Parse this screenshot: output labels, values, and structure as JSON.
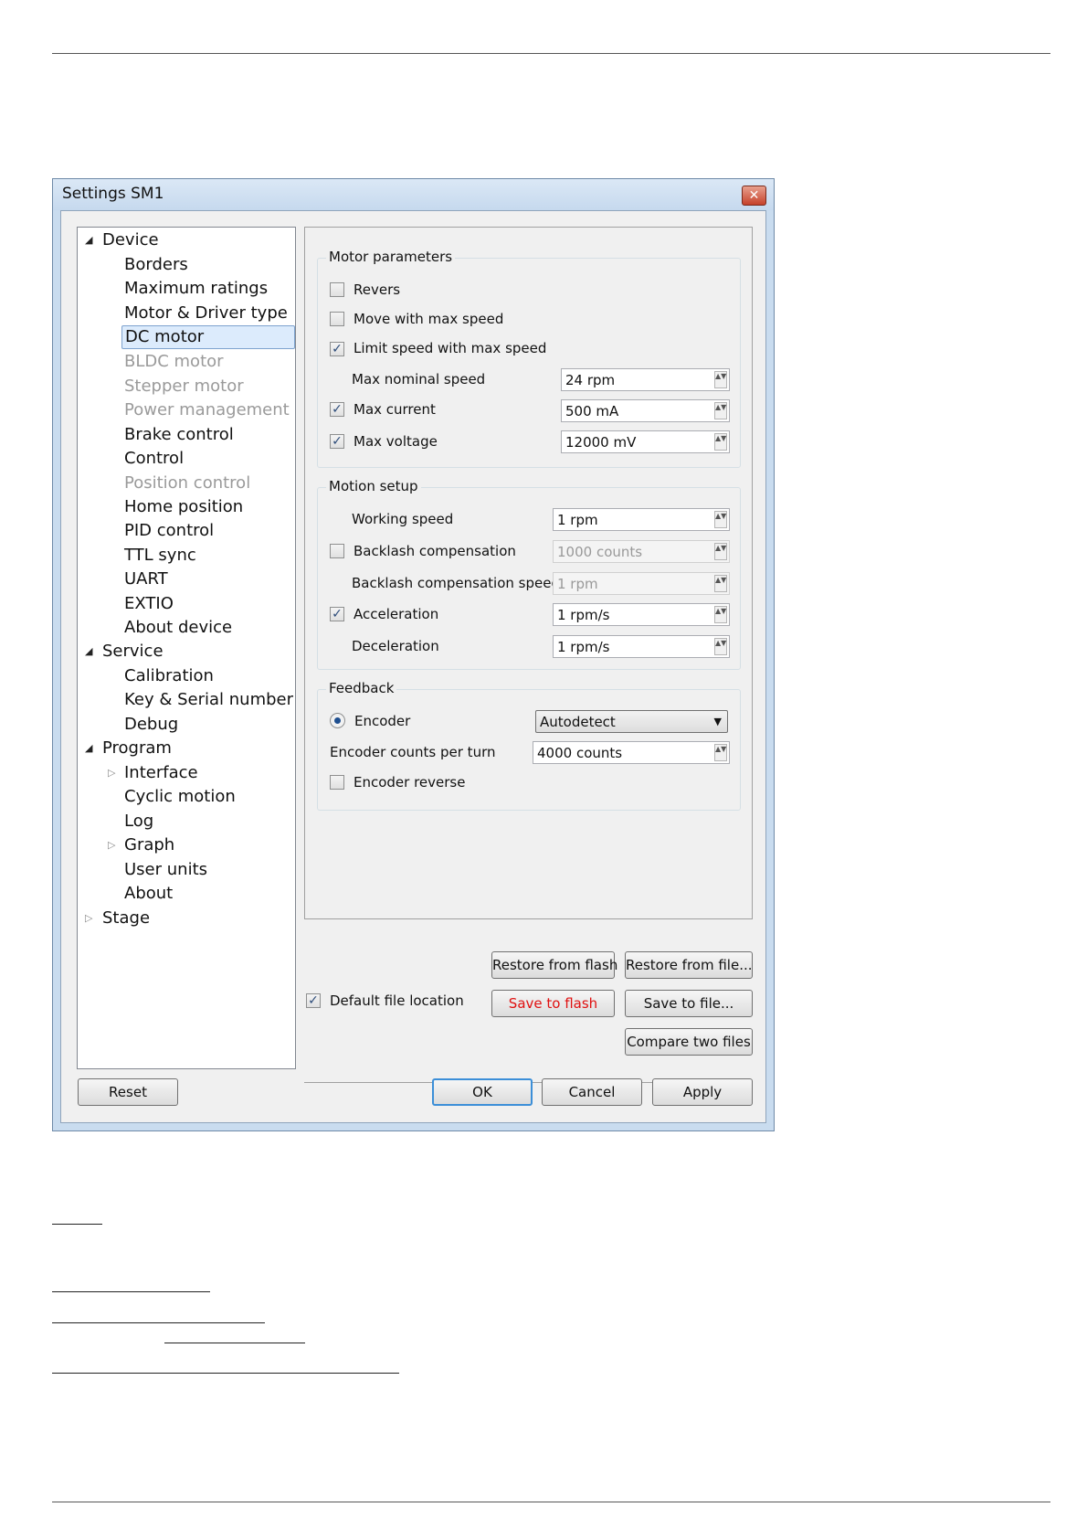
{
  "window": {
    "title": "Settings SM1",
    "close_glyph": "✕"
  },
  "tree": {
    "device": "Device",
    "device_items": [
      "Borders",
      "Maximum ratings",
      "Motor & Driver type",
      "DC motor",
      "BLDC motor",
      "Stepper motor",
      "Power management",
      "Brake control",
      "Control",
      "Position control",
      "Home position",
      "PID control",
      "TTL sync",
      "UART",
      "EXTIO",
      "About device"
    ],
    "service": "Service",
    "service_items": [
      "Calibration",
      "Key & Serial number",
      "Debug"
    ],
    "program": "Program",
    "program_items": [
      "Interface",
      "Cyclic motion",
      "Log",
      "Graph",
      "User units",
      "About"
    ],
    "stage": "Stage"
  },
  "motor": {
    "title": "Motor parameters",
    "revers": "Revers",
    "move_max": "Move with max speed",
    "limit_speed": "Limit speed with max speed",
    "max_nominal_speed": "Max nominal speed",
    "max_nominal_speed_value": "24 rpm",
    "max_current": "Max current",
    "max_current_value": "500 mA",
    "max_voltage": "Max voltage",
    "max_voltage_value": "12000 mV"
  },
  "motion": {
    "title": "Motion setup",
    "working_speed": "Working speed",
    "working_speed_value": "1 rpm",
    "backlash": "Backlash compensation",
    "backlash_value": "1000 counts",
    "backlash_speed": "Backlash compensation speed",
    "backlash_speed_value": "1 rpm",
    "acceleration": "Acceleration",
    "acceleration_value": "1 rpm/s",
    "deceleration": "Deceleration",
    "deceleration_value": "1 rpm/s"
  },
  "feedback": {
    "title": "Feedback",
    "encoder": "Encoder",
    "encoder_select": "Autodetect",
    "counts_per_turn": "Encoder counts per turn",
    "counts_per_turn_value": "4000 counts",
    "encoder_reverse": "Encoder reverse"
  },
  "file": {
    "restore_flash": "Restore from flash",
    "restore_file": "Restore from file...",
    "default_location": "Default file location",
    "save_flash": "Save to flash",
    "save_file": "Save to file...",
    "compare": "Compare two files"
  },
  "footer": {
    "reset": "Reset",
    "ok": "OK",
    "cancel": "Cancel",
    "apply": "Apply"
  },
  "glyphs": {
    "check": "✓",
    "expanded": "◢",
    "collapsed": "▷",
    "spin": "▲▼",
    "caret": "▼"
  }
}
